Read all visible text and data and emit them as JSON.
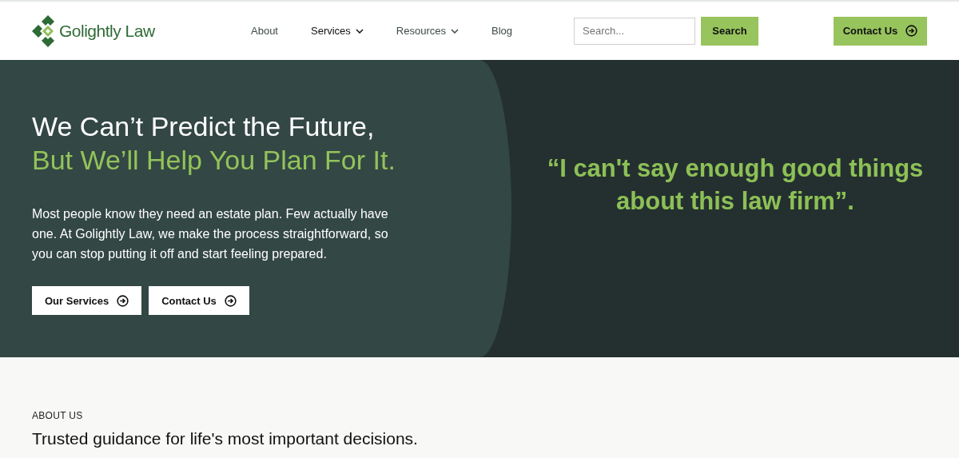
{
  "header": {
    "logo": "Golightly Law",
    "nav": [
      {
        "label": "About",
        "has_menu": false,
        "selected": false
      },
      {
        "label": "Services",
        "has_menu": true,
        "selected": true
      },
      {
        "label": "Resources",
        "has_menu": true,
        "selected": false
      },
      {
        "label": "Blog",
        "has_menu": false,
        "selected": false
      }
    ],
    "search": {
      "placeholder": "Search...",
      "button": "Search"
    },
    "contact_button": "Contact Us"
  },
  "hero": {
    "title_line_1": "We Can’t Predict the Future,",
    "title_line_2": "But We’ll Help You Plan For It.",
    "text": "Most people know they need an estate plan. Few actually have one. At Golightly Law, we make the process straightforward, so you can stop putting it off and start feeling prepared.",
    "buttons": [
      "Our Services",
      "Contact Us"
    ],
    "quote": "“I can't say enough good things about this law firm”."
  },
  "about": {
    "eyebrow": "ABOUT US",
    "heading": "Trusted guidance for life's most important decisions."
  }
}
